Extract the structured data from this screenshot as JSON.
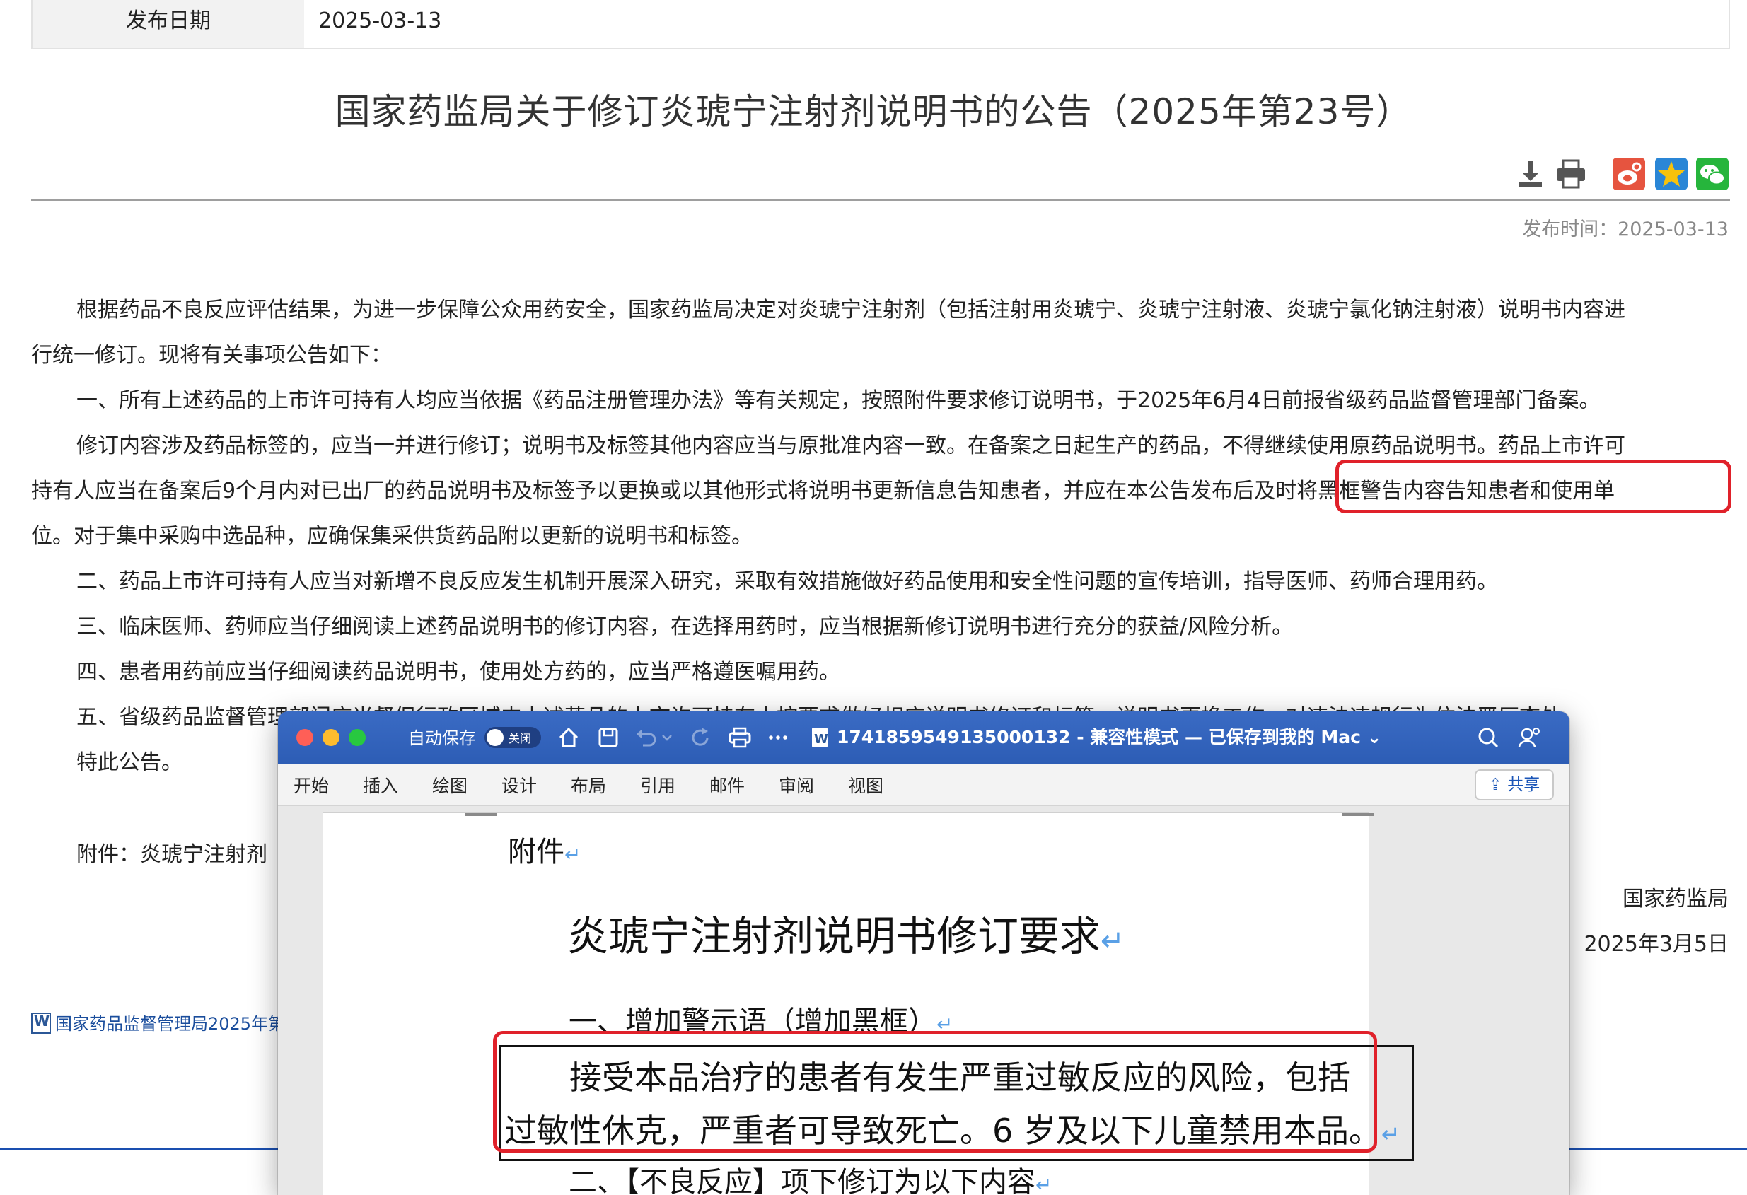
{
  "meta": {
    "date_label": "发布日期",
    "date_value": "2025-03-13"
  },
  "title": "国家药监局关于修订炎琥宁注射剂说明书的公告（2025年第23号）",
  "tool_icons": [
    "download-icon",
    "print-icon",
    "weibo-icon",
    "qzone-icon",
    "wechat-icon"
  ],
  "publish_time": "发布时间：2025-03-13",
  "body": {
    "p1_l1": "根据药品不良反应评估结果，为进一步保障公众用药安全，国家药监局决定对炎琥宁注射剂（包括注射用炎琥宁、炎琥宁注射液、炎琥宁氯化钠注射液）说明书内容进",
    "p1_l2": "行统一修订。现将有关事项公告如下：",
    "p2": "一、所有上述药品的上市许可持有人均应当依据《药品注册管理办法》等有关规定，按照附件要求修订说明书，于2025年6月4日前报省级药品监督管理部门备案。",
    "p3_l1": "修订内容涉及药品标签的，应当一并进行修订；说明书及标签其他内容应当与原批准内容一致。在备案之日起生产的药品，不得继续使用原药品说明书。药品上市许可",
    "p3_l2": "持有人应当在备案后9个月内对已出厂的药品说明书及标签予以更换或以其他形式将说明书更新信息告知患者，并应在本公告发布后及时将黑框警告内容告知患者和使用单",
    "p3_l3": "位。对于集中采购中选品种，应确保集采供货药品附以更新的说明书和标签。",
    "p4": "二、药品上市许可持有人应当对新增不良反应发生机制开展深入研究，采取有效措施做好药品使用和安全性问题的宣传培训，指导医师、药师合理用药。",
    "p5": "三、临床医师、药师应当仔细阅读上述药品说明书的修订内容，在选择用药时，应当根据新修订说明书进行充分的获益/风险分析。",
    "p6": "四、患者用药前应当仔细阅读药品说明书，使用处方药的，应当严格遵医嘱用药。",
    "p7": "五、省级药品监督管理部门应当督促行政区域内上述药品的上市许可持有人按要求做好相应说明书修订和标签、说明书更换工作，对违法违规行为依法严厉查处。",
    "p8": "特此公告。",
    "attachment": "附件：炎琥宁注射剂",
    "sign_org": "国家药监局",
    "sign_date": "2025年3月5日",
    "attach_link": "国家药品监督管理局2025年第"
  },
  "word": {
    "autosave": "自动保存",
    "toggle_label": "关闭",
    "doc_title": "1741859549135000132  -  兼容性模式 — 已保存到我的 Mac",
    "ribbon": [
      "开始",
      "插入",
      "绘图",
      "设计",
      "布局",
      "引用",
      "邮件",
      "审阅",
      "视图"
    ],
    "share": "共享",
    "doc": {
      "attach": "附件",
      "heading": "炎琥宁注射剂说明书修订要求",
      "sec1": "一、增加警示语（增加黑框）",
      "warn_l1": "接受本品治疗的患者有发生严重过敏反应的风险，包括",
      "warn_l2": "过敏性休克，严重者可导致死亡。6 岁及以下儿童禁用本品。",
      "sec2": "二、【不良反应】项下修订为以下内容",
      "return_mark": "↵"
    }
  }
}
